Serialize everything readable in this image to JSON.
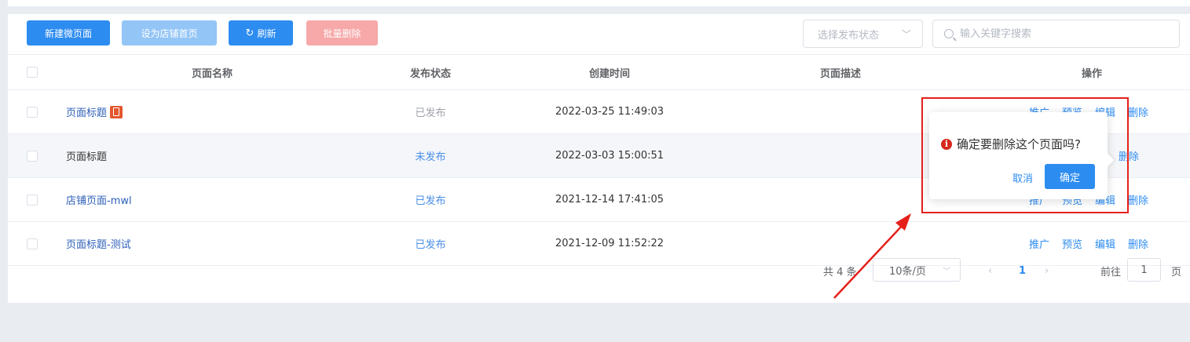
{
  "toolbar": {
    "new_label": "新建微页面",
    "set_home_label": "设为店铺首页",
    "refresh_label": "刷新",
    "batch_delete_label": "批量删除",
    "status_placeholder": "选择发布状态",
    "search_placeholder": "输入关键字搜索"
  },
  "table": {
    "headers": {
      "name": "页面名称",
      "status": "发布状态",
      "created": "创建时间",
      "desc": "页面描述",
      "ops": "操作"
    },
    "rows": [
      {
        "name": "页面标题",
        "status": "已发布",
        "created": "2022-03-25 11:49:03",
        "desc": "",
        "ops": [
          "推广",
          "预览",
          "编辑",
          "删除"
        ]
      },
      {
        "name": "页面标题",
        "status": "未发布",
        "created": "2022-03-03 15:00:51",
        "desc": "",
        "ops": [
          "删除"
        ]
      },
      {
        "name": "店铺页面-mwl",
        "status": "已发布",
        "created": "2021-12-14 17:41:05",
        "desc": "",
        "ops": [
          "推广",
          "预览",
          "编辑",
          "删除"
        ]
      },
      {
        "name": "页面标题-测试",
        "status": "已发布",
        "created": "2021-12-09 11:52:22",
        "desc": "",
        "ops": [
          "推广",
          "预览",
          "编辑",
          "删除"
        ]
      }
    ]
  },
  "pagination": {
    "total": "共 4 条",
    "page_size": "10条/页",
    "current_page": "1",
    "goto_label": "前往",
    "goto_value": "1",
    "page_suffix": "页"
  },
  "popconfirm": {
    "message": "确定要删除这个页面吗?",
    "cancel_label": "取消",
    "ok_label": "确定"
  },
  "colors": {
    "primary": "#2d8cf0",
    "danger_light": "#f7a8a8",
    "annotation_red": "#e5201b"
  }
}
